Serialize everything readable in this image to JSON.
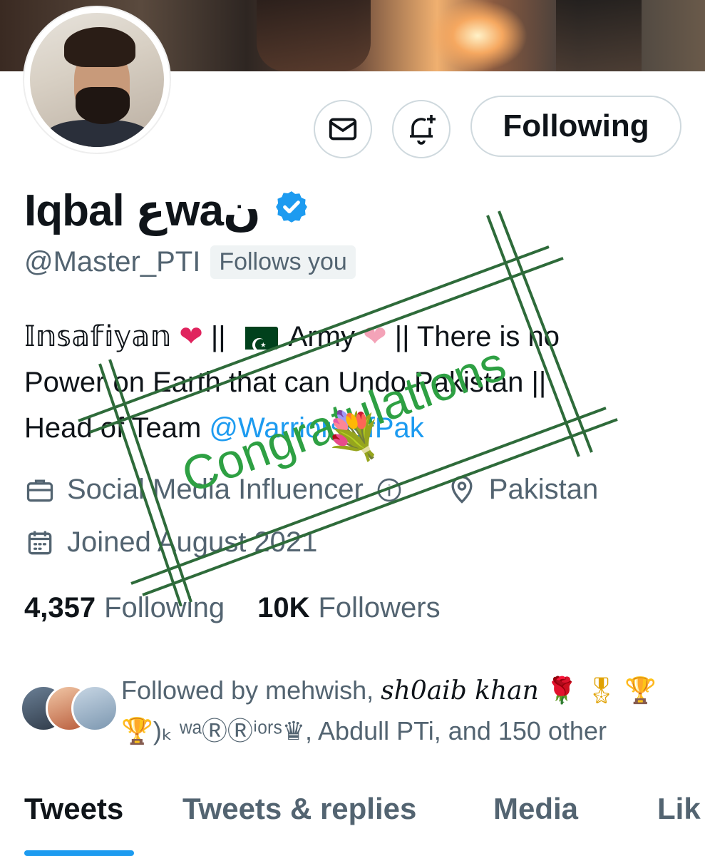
{
  "banner": {
    "description": "cover photo"
  },
  "profile": {
    "name": "Iqbal ﻉwaﻥ",
    "handle": "@Master_PTI",
    "follows_you": "Follows you",
    "bio": {
      "line1_a": "𝕀𝕟𝕤𝕒𝕗𝕚𝕪𝕒𝕟",
      "line1_b": "||",
      "line1_c": "Army",
      "line1_d": "|| There is no",
      "line2": "Power on Earth that can Undo Pakistan ||",
      "line3_a": "Head of Team ",
      "line3_link": "@WarriorsOfPak"
    },
    "profession": "Social Media Influencer",
    "location": "Pakistan",
    "joined": "Joined August 2021"
  },
  "actions": {
    "message_icon": "mail-icon",
    "notify_icon": "bell-plus-icon",
    "follow_label": "Following"
  },
  "stats": {
    "following_count": "4,357",
    "following_label": "Following",
    "followers_count": "10K",
    "followers_label": "Followers"
  },
  "followed_by": {
    "line1_a": "Followed by mehwish, ",
    "line1_script": "sh0aib khan",
    "line2": ")ₖ ʷᵃⓇⓇⁱᵒʳˢ♛, Abdull PTi, and 150 other"
  },
  "tabs": [
    "Tweets",
    "Tweets & replies",
    "Media",
    "Lik"
  ],
  "overlay": {
    "stamp_text": "Congratulations"
  },
  "colors": {
    "accent": "#1d9bf0",
    "stamp_green": "#2e7d32",
    "stamp_text": "#2ea043"
  }
}
